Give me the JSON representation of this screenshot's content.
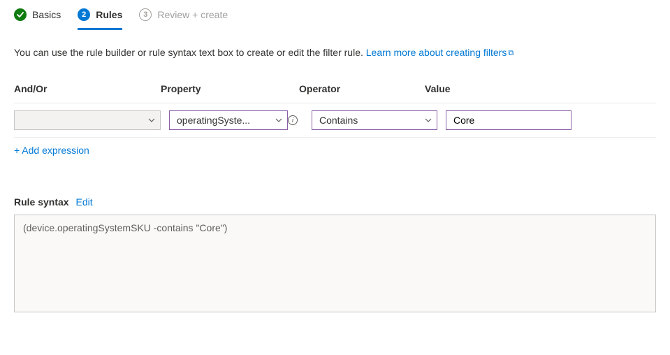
{
  "tabs": {
    "basics": {
      "label": "Basics"
    },
    "rules": {
      "num": "2",
      "label": "Rules"
    },
    "review": {
      "num": "3",
      "label": "Review + create"
    }
  },
  "info_prefix": "You can use the rule builder or rule syntax text box to create or edit the filter rule. ",
  "info_link": "Learn more about creating filters",
  "columns": {
    "andor": "And/Or",
    "property": "Property",
    "operator": "Operator",
    "value": "Value"
  },
  "row": {
    "andor": "",
    "property": "operatingSyste...",
    "operator": "Contains",
    "value": "Core"
  },
  "add_expression": "+ Add expression",
  "rule_syntax_label": "Rule syntax",
  "edit_label": "Edit",
  "rule_syntax_value": "(device.operatingSystemSKU -contains \"Core\")"
}
